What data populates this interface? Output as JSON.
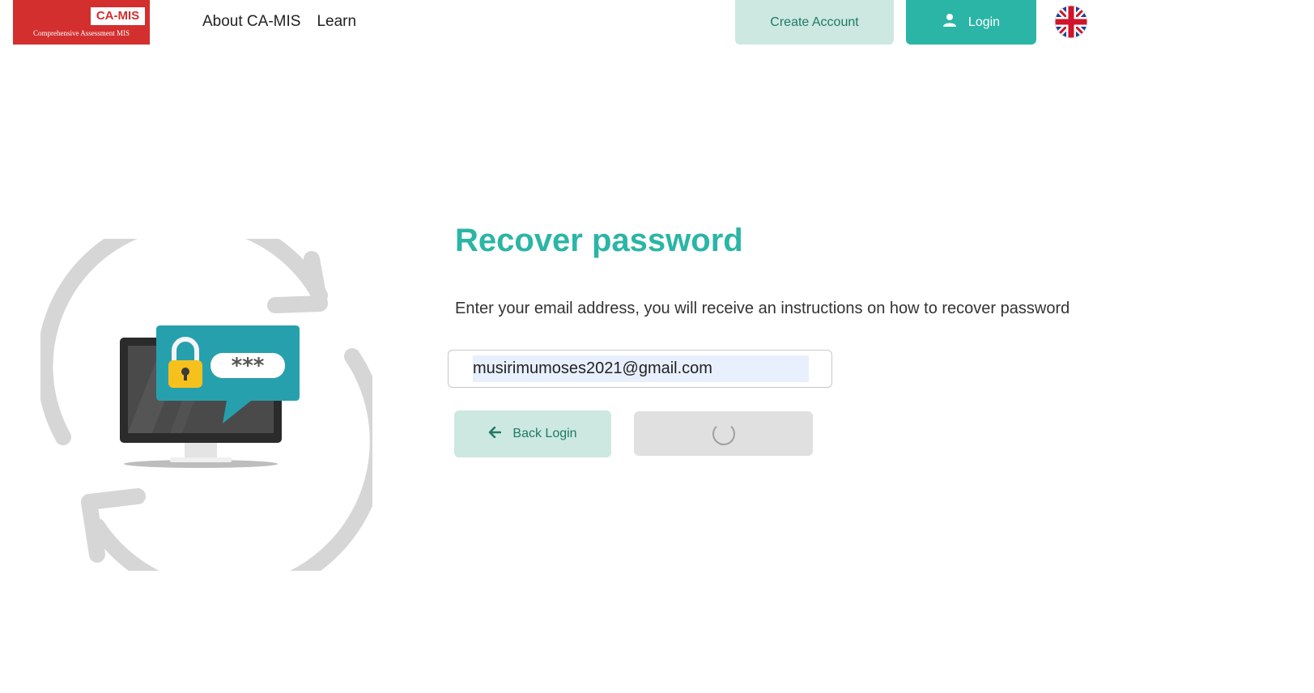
{
  "header": {
    "logo_mark": "CA-MIS",
    "logo_tagline": "Comprehensive Assessment MIS",
    "nav": [
      {
        "label": "About CA-MIS"
      },
      {
        "label": "Learn"
      }
    ],
    "create_account_label": "Create Account",
    "login_label": "Login",
    "language_icon": "uk-flag-icon"
  },
  "main": {
    "title": "Recover password",
    "description": "Enter your email address, you will receive an instructions on how to recover password",
    "email_value": "musirimumoses2021@gmail.com",
    "back_label": "Back Login",
    "submit_state": "loading"
  },
  "colors": {
    "accent": "#2bb5a6",
    "accent_light": "#cce8e1",
    "brand_red": "#d32f2f"
  }
}
